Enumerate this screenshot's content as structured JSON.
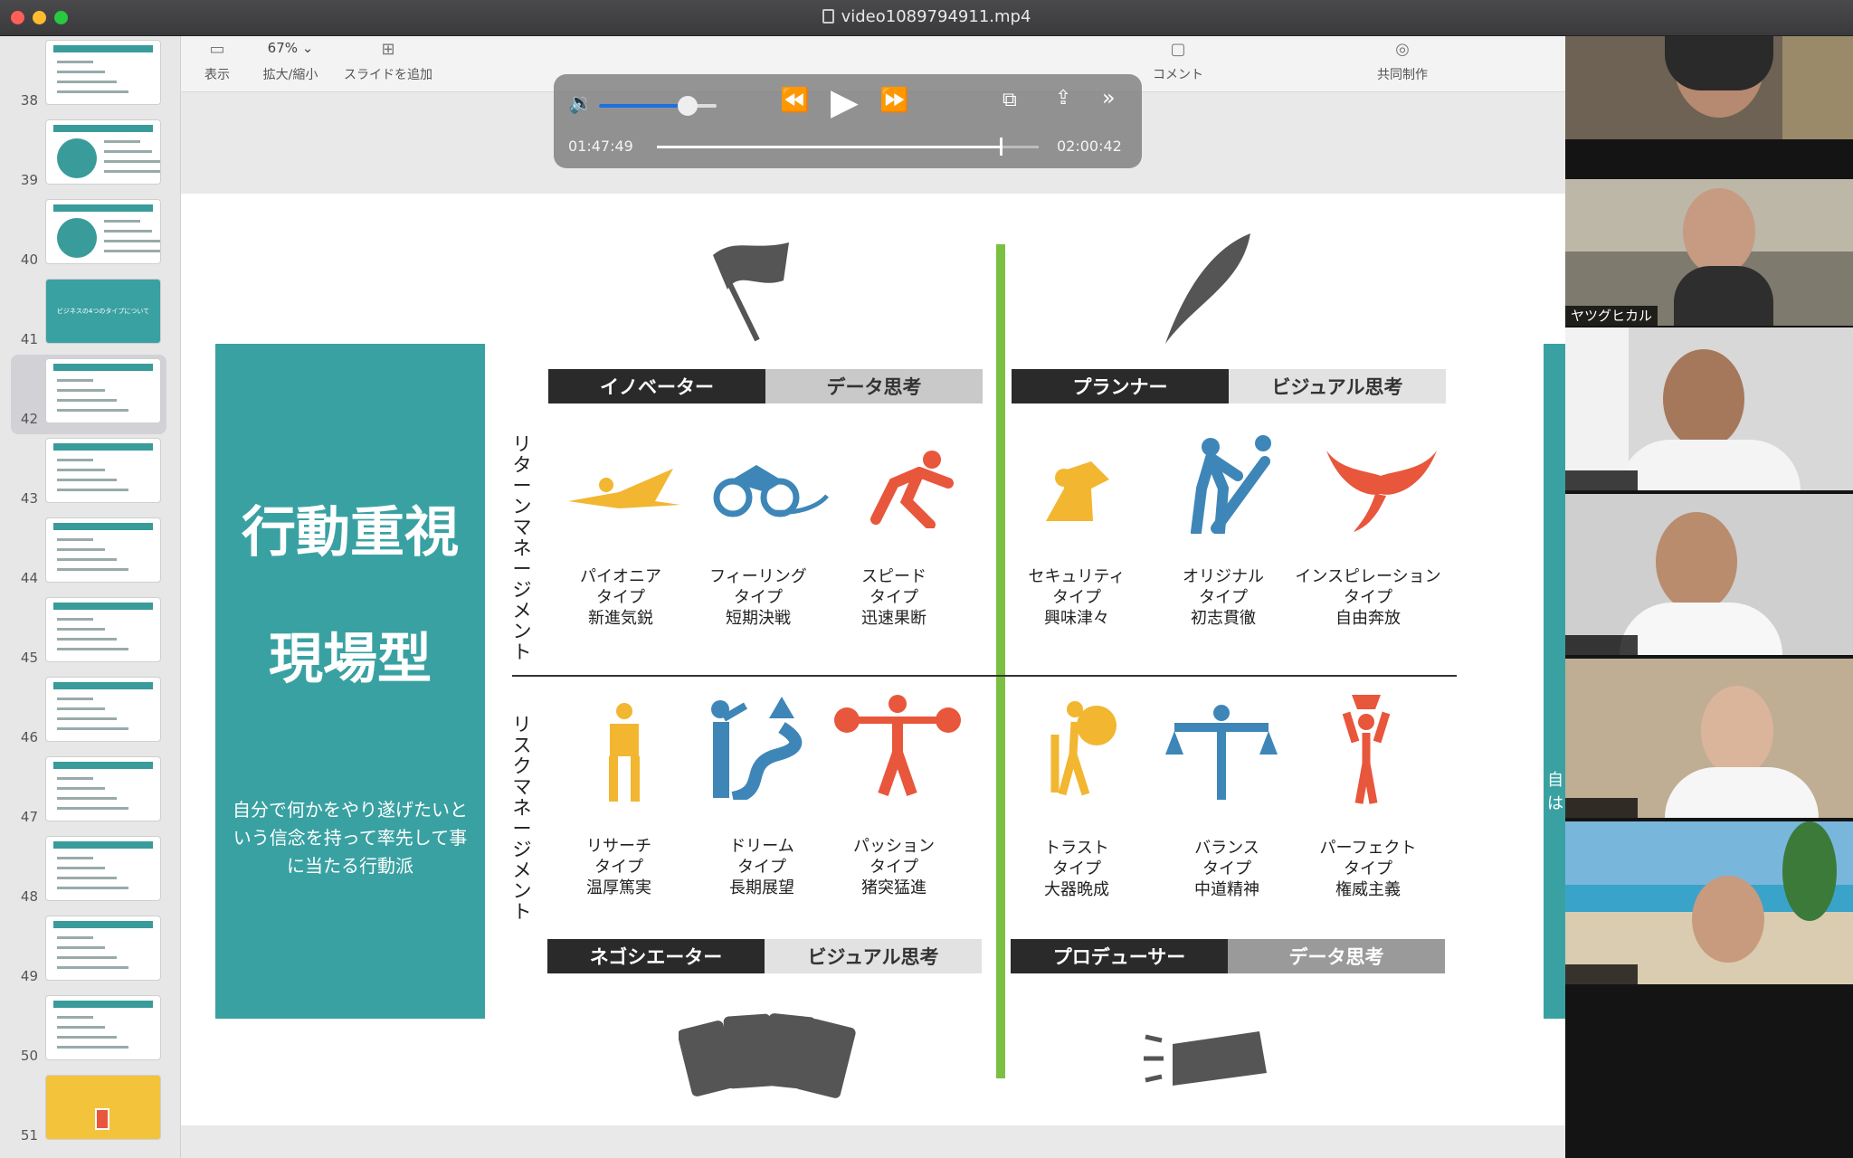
{
  "window": {
    "title": "video1089794911.mp4"
  },
  "toolbar": {
    "view_label": "表示",
    "zoom_value": "67%",
    "zoom_label": "拡大/縮小",
    "add_slide_label": "スライドを追加",
    "comment_label": "コメント",
    "collab_label": "共同制作"
  },
  "player": {
    "elapsed": "01:47:49",
    "remaining": "02:00:42",
    "progress": 0.9,
    "volume": 0.75
  },
  "sidebar": {
    "slides": [
      "38",
      "39",
      "40",
      "41",
      "42",
      "43",
      "44",
      "45",
      "46",
      "47",
      "48",
      "49",
      "50",
      "51"
    ],
    "selected": "42",
    "slide41_caption": "ビジネスの4つのタイプについて"
  },
  "slide": {
    "panel_title_1": "行動重視",
    "panel_title_2": "現場型",
    "panel_desc": "自分で何かをやり遂げたいという信念を持って率先して事に当たる行動派",
    "top_left": {
      "role": "イノベーター",
      "style": "データ思考"
    },
    "top_right": {
      "role": "プランナー",
      "style": "ビジュアル思考"
    },
    "bottom_left": {
      "role": "ネゴシエーター",
      "style": "ビジュアル思考"
    },
    "bottom_right": {
      "role": "プロデューサー",
      "style": "データ思考"
    },
    "axis_top": "リターンマネージメント",
    "axis_bottom": "リスクマネージメント",
    "types": [
      {
        "name": "パイオニア",
        "suffix": "タイプ",
        "motto": "新進気鋭"
      },
      {
        "name": "フィーリング",
        "suffix": "タイプ",
        "motto": "短期決戦"
      },
      {
        "name": "スピード",
        "suffix": "タイプ",
        "motto": "迅速果断"
      },
      {
        "name": "セキュリティ",
        "suffix": "タイプ",
        "motto": "興味津々"
      },
      {
        "name": "オリジナル",
        "suffix": "タイプ",
        "motto": "初志貫徹"
      },
      {
        "name": "インスピレーション",
        "suffix": "タイプ",
        "motto": "自由奔放"
      },
      {
        "name": "リサーチ",
        "suffix": "タイプ",
        "motto": "温厚篤実"
      },
      {
        "name": "ドリーム",
        "suffix": "タイプ",
        "motto": "長期展望"
      },
      {
        "name": "パッション",
        "suffix": "タイプ",
        "motto": "猪突猛進"
      },
      {
        "name": "トラスト",
        "suffix": "タイプ",
        "motto": "大器晩成"
      },
      {
        "name": "バランス",
        "suffix": "タイプ",
        "motto": "中道精神"
      },
      {
        "name": "パーフェクト",
        "suffix": "タイプ",
        "motto": "権威主義"
      }
    ],
    "right_strip_text": "自は"
  },
  "participants": [
    {
      "name": ""
    },
    {
      "name": "ヤツグヒカル"
    },
    {
      "name": ""
    },
    {
      "name": ""
    },
    {
      "name": ""
    },
    {
      "name": ""
    }
  ],
  "colors": {
    "teal": "#3aa1a2",
    "green": "#7bc043",
    "orange": "#e8563c",
    "yellow": "#f2b631",
    "blue": "#3e86b8"
  }
}
